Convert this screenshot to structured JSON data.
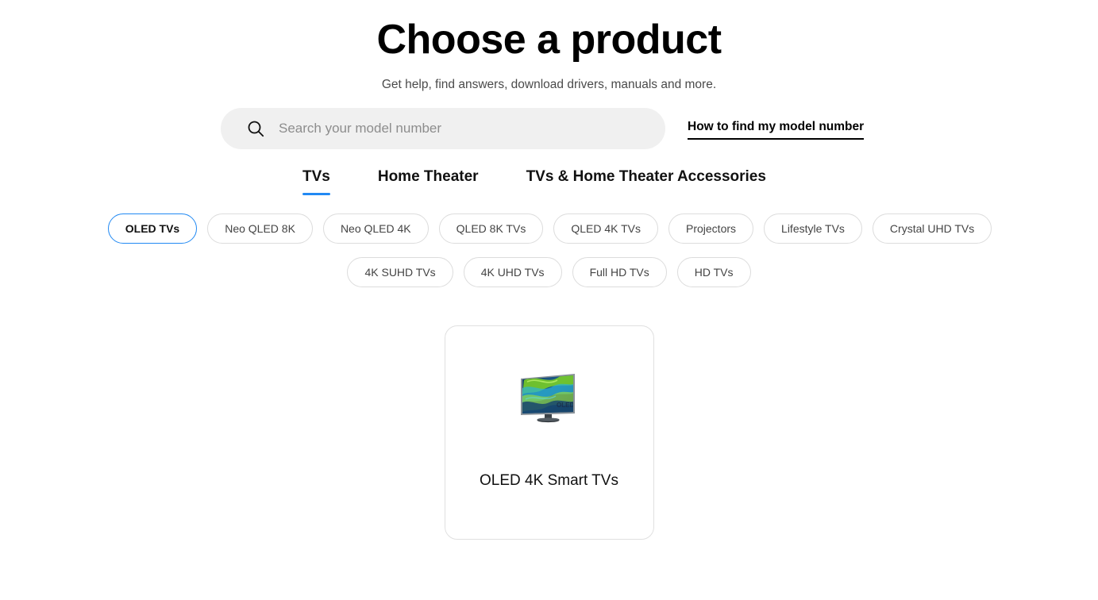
{
  "header": {
    "title": "Choose a product",
    "subtitle": "Get help, find answers, download drivers, manuals and more."
  },
  "search": {
    "placeholder": "Search your model number",
    "value": "",
    "icon": "search-icon",
    "help_link": "How to find my model number"
  },
  "tabs": [
    {
      "label": "TVs",
      "active": true
    },
    {
      "label": "Home Theater",
      "active": false
    },
    {
      "label": "TVs & Home Theater Accessories",
      "active": false
    }
  ],
  "chips": {
    "row1": [
      {
        "label": "OLED TVs",
        "selected": true
      },
      {
        "label": "Neo QLED 8K",
        "selected": false
      },
      {
        "label": "Neo QLED 4K",
        "selected": false
      },
      {
        "label": "QLED 8K TVs",
        "selected": false
      },
      {
        "label": "QLED 4K TVs",
        "selected": false
      },
      {
        "label": "Projectors",
        "selected": false
      },
      {
        "label": "Lifestyle TVs",
        "selected": false
      },
      {
        "label": "Crystal UHD TVs",
        "selected": false
      }
    ],
    "row2": [
      {
        "label": "4K SUHD TVs",
        "selected": false
      },
      {
        "label": "4K UHD TVs",
        "selected": false
      },
      {
        "label": "Full HD TVs",
        "selected": false
      },
      {
        "label": "HD TVs",
        "selected": false
      }
    ]
  },
  "products": [
    {
      "name": "OLED 4K Smart TVs",
      "image": "oled-tv-thumbnail",
      "screen_badge": "OLED"
    }
  ],
  "colors": {
    "accent_blue": "#2189f3",
    "text_primary": "#111111",
    "text_secondary": "#4a4a4a",
    "search_background": "#f0f0f0",
    "border_light": "#dcdcdc"
  }
}
